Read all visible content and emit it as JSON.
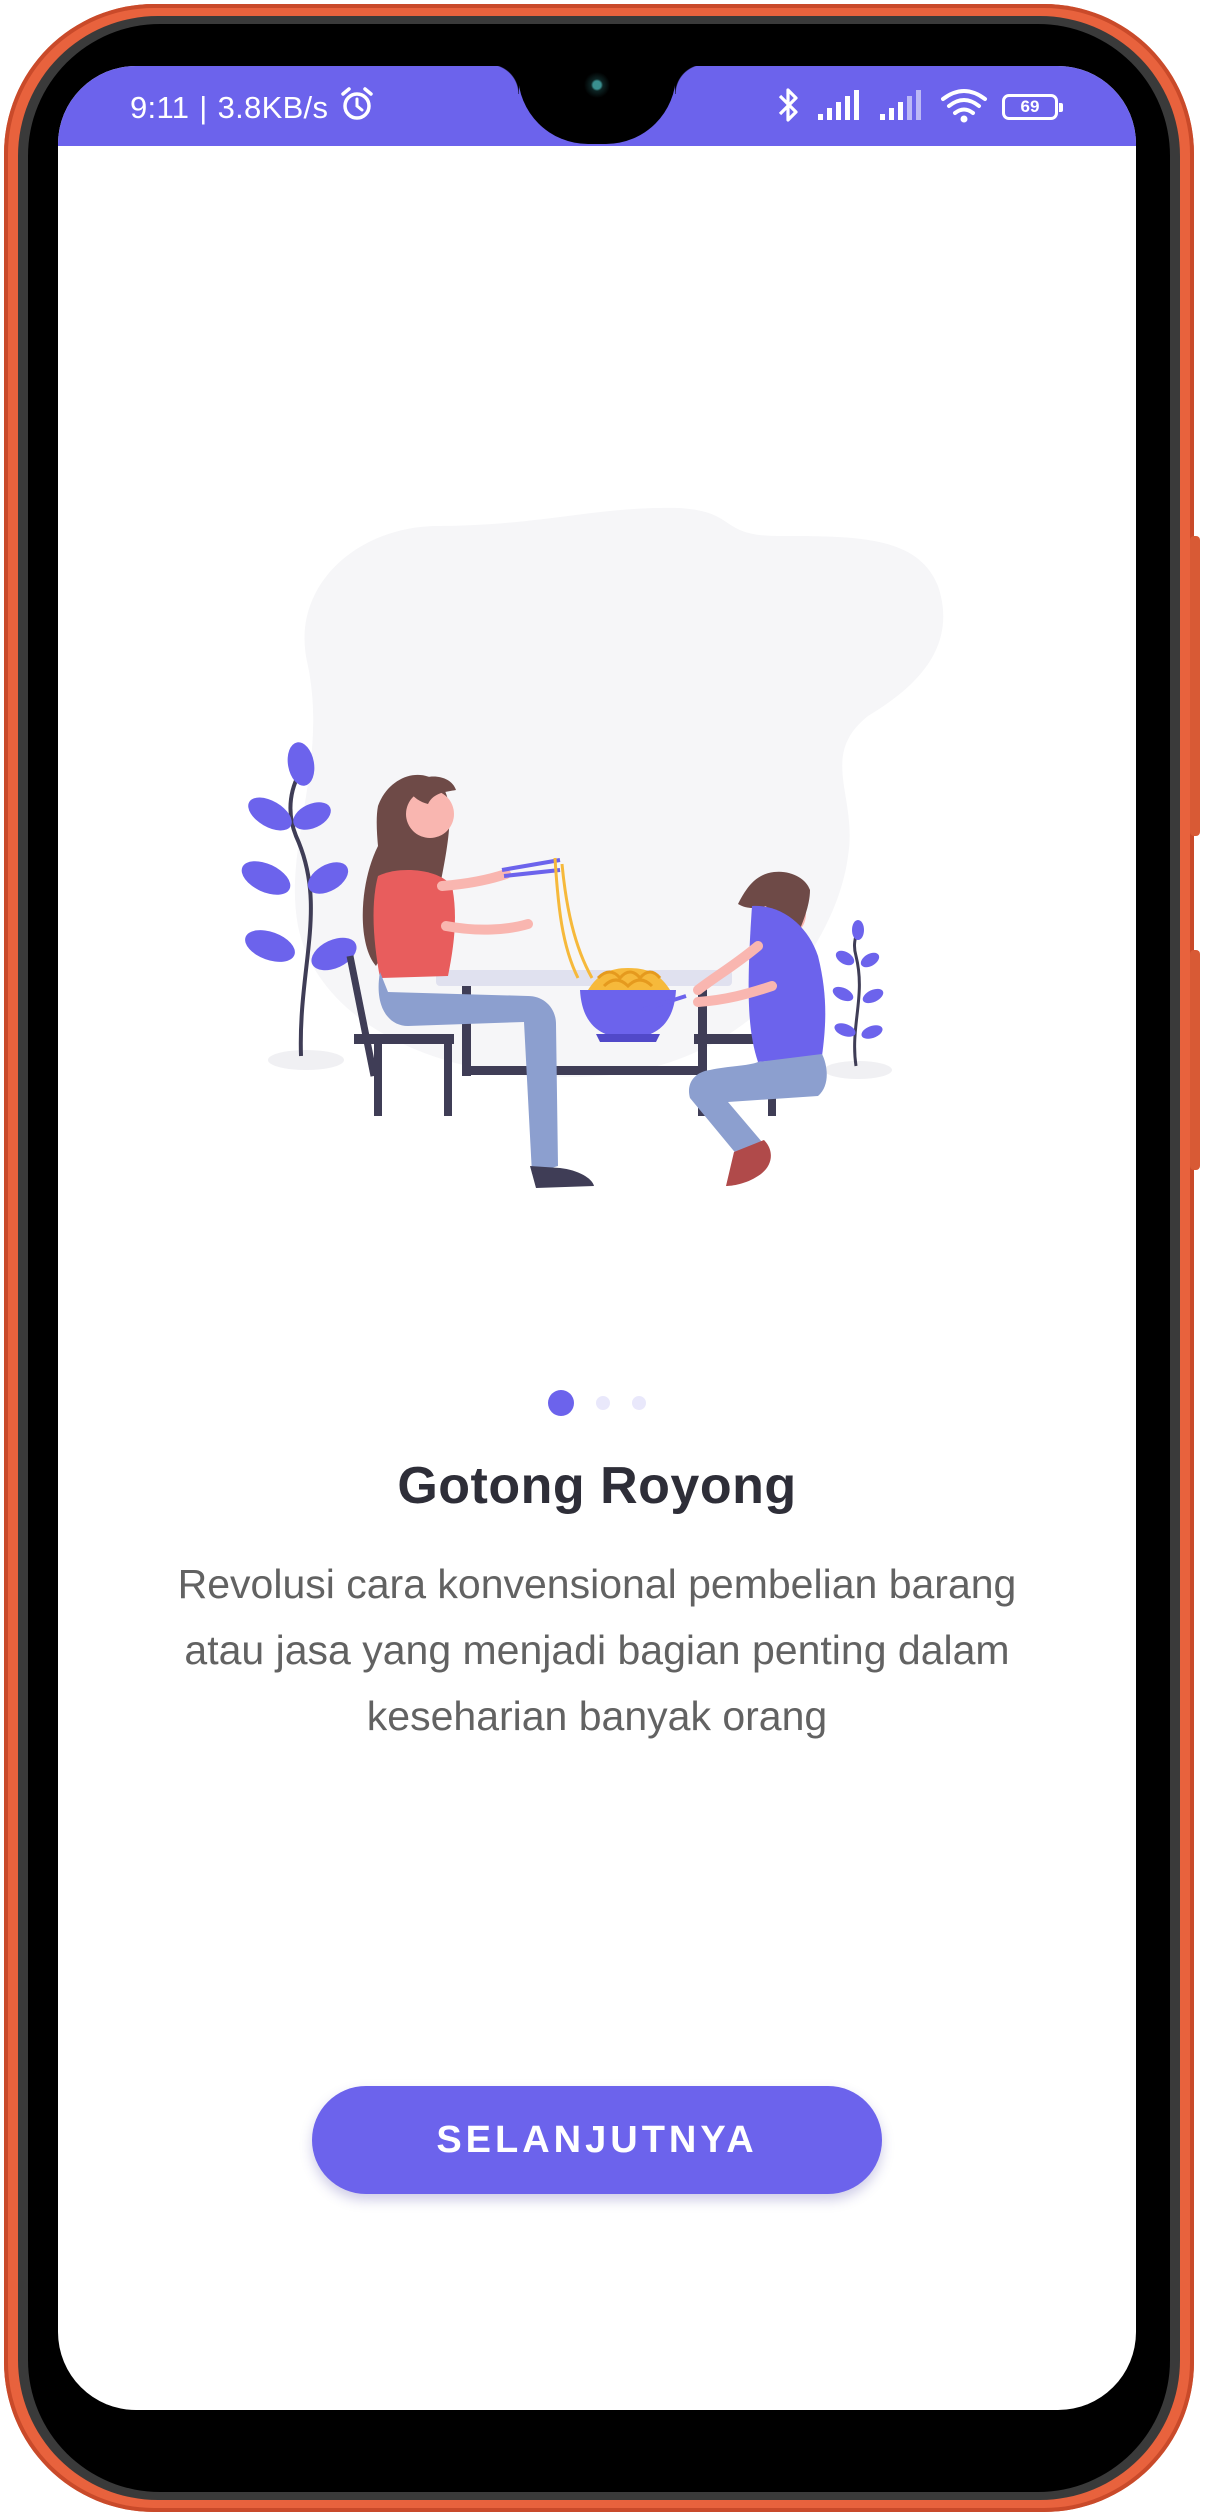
{
  "colors": {
    "accent": "#6c63ec",
    "frame": "#e8623d",
    "title": "#2e2e38",
    "body": "#626262"
  },
  "status_bar": {
    "time": "9:11",
    "separator": "|",
    "network_speed": "3.8KB/s",
    "alarm_icon": "alarm-clock-icon",
    "bluetooth_icon": "bluetooth-icon",
    "signal_icons": [
      "signal-bars-icon",
      "signal-bars-icon"
    ],
    "wifi_icon": "wifi-icon",
    "battery_level": "69"
  },
  "onboarding": {
    "illustration": "couple-eating-noodles-illustration",
    "page_indicator": {
      "total": 3,
      "active": 1
    },
    "title": "Gotong Royong",
    "description_lines": [
      "Revolusi cara konvensional pembelian barang",
      "atau jasa yang menjadi bagian penting dalam",
      "keseharian banyak orang"
    ],
    "next_button": "SELANJUTNYA"
  }
}
